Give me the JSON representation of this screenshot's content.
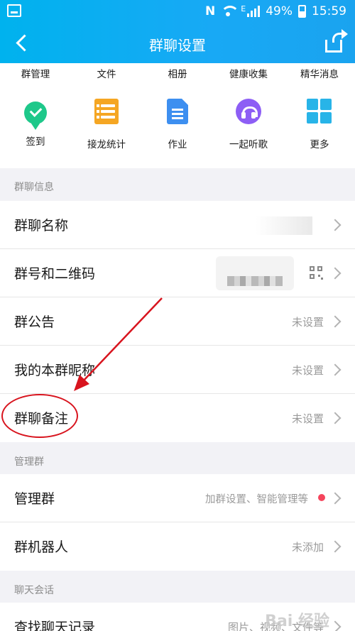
{
  "status_bar": {
    "carrier_icon": "N",
    "battery": "49%",
    "time": "15:59",
    "signal_label": "E"
  },
  "nav": {
    "title": "群聊设置",
    "back_icon": "back-arrow-icon",
    "share_icon": "share-icon"
  },
  "tools_top": [
    "群管理",
    "文件",
    "相册",
    "健康收集",
    "精华消息"
  ],
  "tools": [
    {
      "label": "签到",
      "icon": "check-in-icon",
      "color": "#1ec88a"
    },
    {
      "label": "接龙统计",
      "icon": "list-icon",
      "color": "#f5a623"
    },
    {
      "label": "作业",
      "icon": "document-icon",
      "color": "#3d8ff0"
    },
    {
      "label": "一起听歌",
      "icon": "headphones-icon",
      "color": "#8d5ef5"
    },
    {
      "label": "更多",
      "icon": "grid-icon",
      "color": "#28b4e8"
    }
  ],
  "sections": {
    "group_info": "群聊信息",
    "manage": "管理群",
    "chat": "聊天会话"
  },
  "rows": {
    "group_name": {
      "title": "群聊名称",
      "value": ""
    },
    "group_number": {
      "title": "群号和二维码",
      "value": ""
    },
    "announcement": {
      "title": "群公告",
      "value": "未设置"
    },
    "my_nickname": {
      "title": "我的本群昵称",
      "value": "未设置"
    },
    "group_remark": {
      "title": "群聊备注",
      "value": "未设置"
    },
    "manage_group": {
      "title": "管理群",
      "value": "加群设置、智能管理等"
    },
    "robot": {
      "title": "群机器人",
      "value": "未添加"
    },
    "search_history": {
      "title": "查找聊天记录",
      "value": "图片、视频、文件等"
    }
  },
  "watermark": "Bai 经验"
}
